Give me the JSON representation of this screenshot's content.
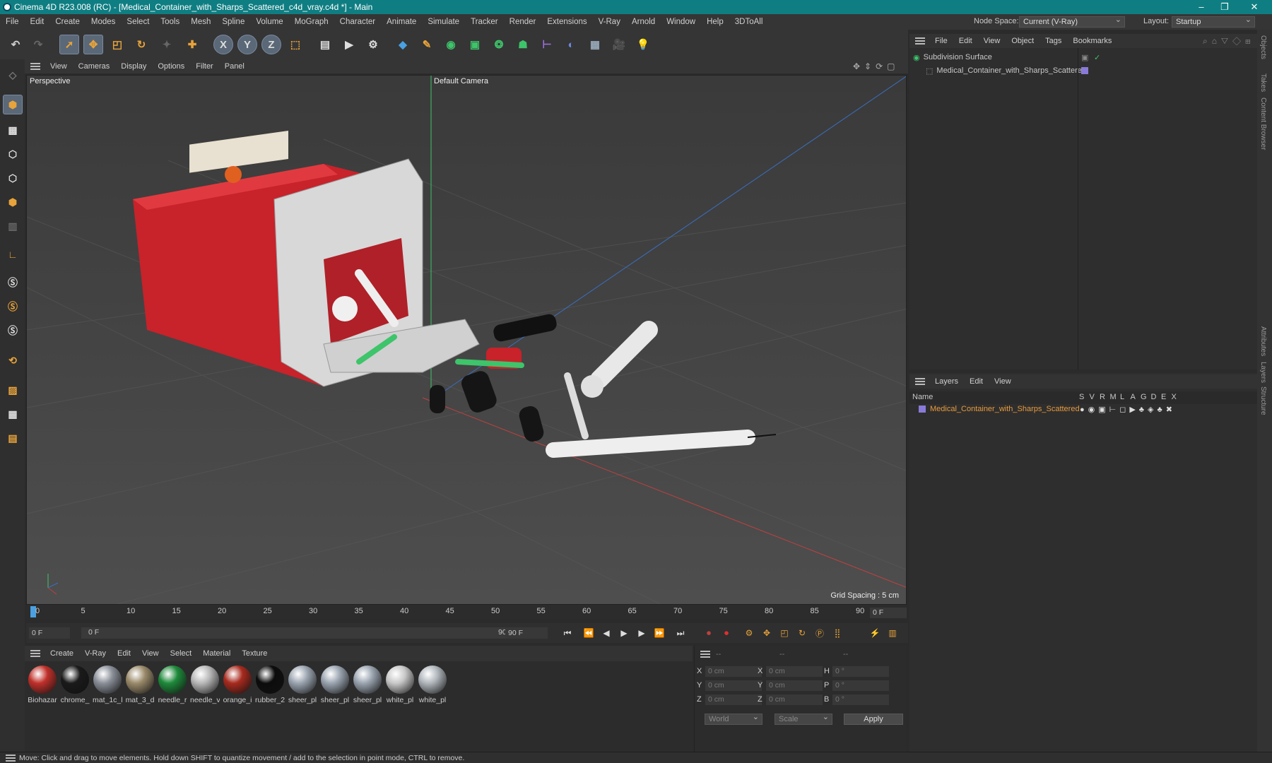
{
  "title_bar": {
    "text": "Cinema 4D R23.008 (RC) - [Medical_Container_with_Sharps_Scattered_c4d_vray.c4d *] - Main"
  },
  "menu": [
    "File",
    "Edit",
    "Create",
    "Modes",
    "Select",
    "Tools",
    "Mesh",
    "Spline",
    "Volume",
    "MoGraph",
    "Character",
    "Animate",
    "Simulate",
    "Tracker",
    "Render",
    "Extensions",
    "V-Ray",
    "Arnold",
    "Window",
    "Help",
    "3DToAll"
  ],
  "node_space": {
    "label": "Node Space:",
    "value": "Current (V-Ray)"
  },
  "layout": {
    "label": "Layout:",
    "value": "Startup"
  },
  "viewport_menu": [
    "View",
    "Cameras",
    "Display",
    "Options",
    "Filter",
    "Panel"
  ],
  "viewport": {
    "name": "Perspective",
    "camera": "Default Camera",
    "grid_spacing": "Grid Spacing : 5 cm"
  },
  "timeline": {
    "ticks": [
      "0",
      "5",
      "10",
      "15",
      "20",
      "25",
      "30",
      "35",
      "40",
      "45",
      "50",
      "55",
      "60",
      "65",
      "70",
      "75",
      "80",
      "85",
      "90"
    ],
    "end_frame": "0 F"
  },
  "transport": {
    "current": "0 F",
    "start": "0 F",
    "range_end": "90 F",
    "end": "90 F"
  },
  "material_menu": [
    "Create",
    "V-Ray",
    "Edit",
    "View",
    "Select",
    "Material",
    "Texture"
  ],
  "materials": [
    {
      "label": "Biohazar",
      "color": "#c0302a"
    },
    {
      "label": "chrome_",
      "color": "#1a1a1a"
    },
    {
      "label": "mat_1c_l",
      "color": "#8a8f98"
    },
    {
      "label": "mat_3_d",
      "color": "#9a8a6a"
    },
    {
      "label": "needle_r",
      "color": "#1e8a3a"
    },
    {
      "label": "needle_v",
      "color": "#b8b8b8"
    },
    {
      "label": "orange_i",
      "color": "#a82a1e"
    },
    {
      "label": "rubber_2",
      "color": "#0c0c0c"
    },
    {
      "label": "sheer_pl",
      "color": "#9aa4b0"
    },
    {
      "label": "sheer_pl",
      "color": "#9aa4b0"
    },
    {
      "label": "sheer_pl",
      "color": "#9aa4b0"
    },
    {
      "label": "white_pl",
      "color": "#c8c8c8"
    },
    {
      "label": "white_pl",
      "color": "#b0b6bc"
    }
  ],
  "coords": {
    "headers": [
      "--",
      "--",
      "--"
    ],
    "rows": [
      {
        "a": "X",
        "av": "0 cm",
        "b": "X",
        "bv": "0 cm",
        "c": "H",
        "cv": "0 °"
      },
      {
        "a": "Y",
        "av": "0 cm",
        "b": "Y",
        "bv": "0 cm",
        "c": "P",
        "cv": "0 °"
      },
      {
        "a": "Z",
        "av": "0 cm",
        "b": "Z",
        "bv": "0 cm",
        "c": "B",
        "cv": "0 °"
      }
    ],
    "world": "World",
    "scale": "Scale",
    "apply": "Apply"
  },
  "objects_menu": [
    "File",
    "Edit",
    "View",
    "Object",
    "Tags",
    "Bookmarks"
  ],
  "objects": [
    {
      "name": "Subdivision Surface",
      "color": "#d0d0d0"
    },
    {
      "name": "Medical_Container_with_Sharps_Scattered",
      "color": "#d0d0d0"
    }
  ],
  "layers_menu": [
    "Layers",
    "Edit",
    "View"
  ],
  "layers_header": {
    "name": "Name",
    "cols": [
      "S",
      "V",
      "R",
      "M",
      "L",
      "A",
      "G",
      "D",
      "E",
      "X"
    ]
  },
  "layers": [
    {
      "name": "Medical_Container_with_Sharps_Scattered",
      "color": "#e89a3c"
    }
  ],
  "side_tabs": [
    "Objects",
    "Takes",
    "Content Browser",
    "Attributes",
    "Layers",
    "Structure"
  ],
  "status": "Move: Click and drag to move elements. Hold down SHIFT to quantize movement / add to the selection in point mode, CTRL to remove.",
  "colors": {
    "title": "#0f7e82",
    "accent": "#e89a3c"
  }
}
